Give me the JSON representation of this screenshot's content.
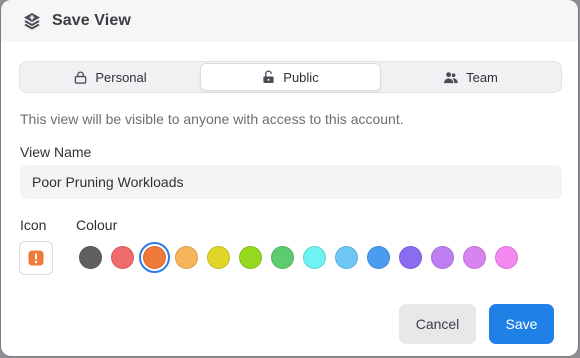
{
  "dialog": {
    "title": "Save View",
    "title_icon": "layers-plus-icon"
  },
  "visibility": {
    "options": [
      {
        "label": "Personal",
        "icon": "lock-icon"
      },
      {
        "label": "Public",
        "icon": "unlock-icon"
      },
      {
        "label": "Team",
        "icon": "users-icon"
      }
    ],
    "selected": "Public",
    "description": "This view will be visible to anyone with access to this account."
  },
  "form": {
    "view_name_label": "View Name",
    "view_name_value": "Poor Pruning Workloads",
    "icon_label": "Icon",
    "icon_value": "alert-square-icon",
    "icon_color": "#f07a3a",
    "colour_label": "Colour",
    "colours": [
      "#606060",
      "#f06b6b",
      "#f07a3a",
      "#f6b55a",
      "#e0d62a",
      "#96d81e",
      "#5ccc6f",
      "#6ff2f2",
      "#6dc8f4",
      "#4b9bf0",
      "#8a6cf0",
      "#bd7ff2",
      "#d884f0",
      "#f388f0"
    ],
    "selected_colour_index": 2
  },
  "footer": {
    "cancel_label": "Cancel",
    "save_label": "Save"
  }
}
